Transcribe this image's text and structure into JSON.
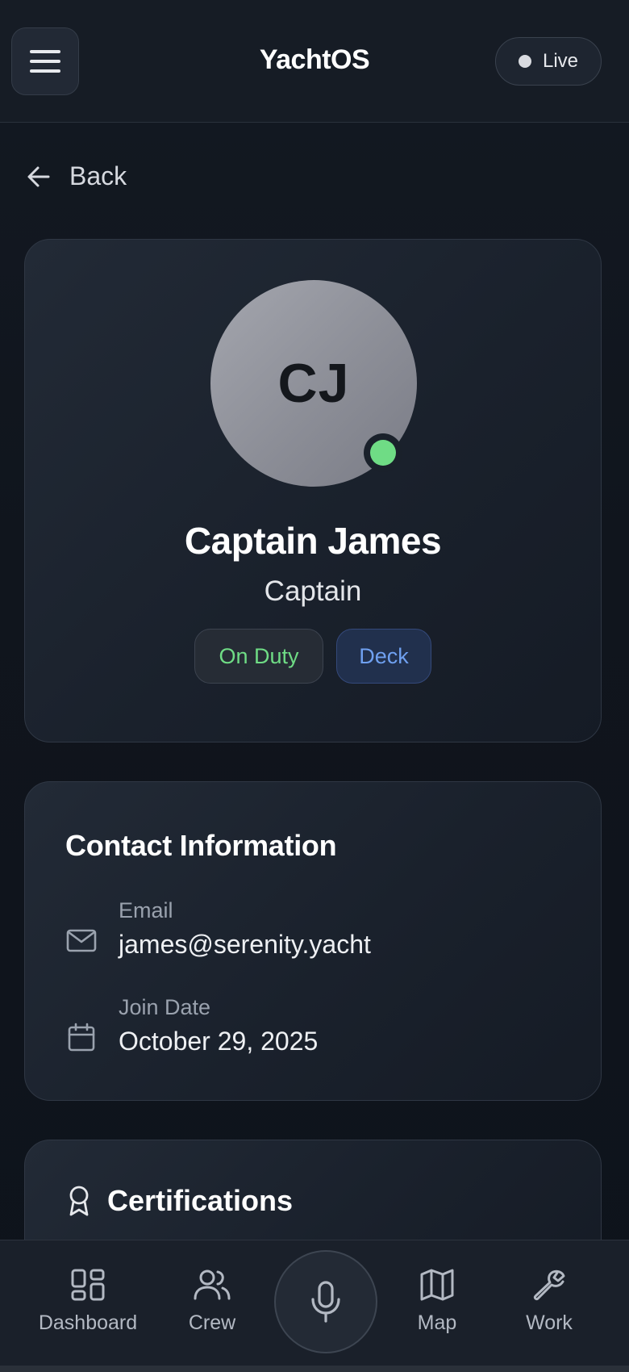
{
  "header": {
    "title": "YachtOS",
    "live_label": "Live"
  },
  "back_label": "Back",
  "profile": {
    "initials": "CJ",
    "name": "Captain James",
    "role": "Captain",
    "status_badge": "On Duty",
    "department_badge": "Deck",
    "online": true
  },
  "contact": {
    "title": "Contact Information",
    "email_label": "Email",
    "email_value": "james@serenity.yacht",
    "join_label": "Join Date",
    "join_value": "October 29, 2025"
  },
  "certifications": {
    "title": "Certifications"
  },
  "nav": {
    "items": [
      {
        "label": "Dashboard",
        "icon": "dashboard-icon"
      },
      {
        "label": "Crew",
        "icon": "users-icon"
      },
      {
        "label": "",
        "icon": "microphone-icon"
      },
      {
        "label": "Map",
        "icon": "map-icon"
      },
      {
        "label": "Work",
        "icon": "wrench-icon"
      }
    ]
  },
  "colors": {
    "on_duty": "#6fdc85",
    "department": "#6fa0f0",
    "online_dot": "#6fdc85"
  }
}
